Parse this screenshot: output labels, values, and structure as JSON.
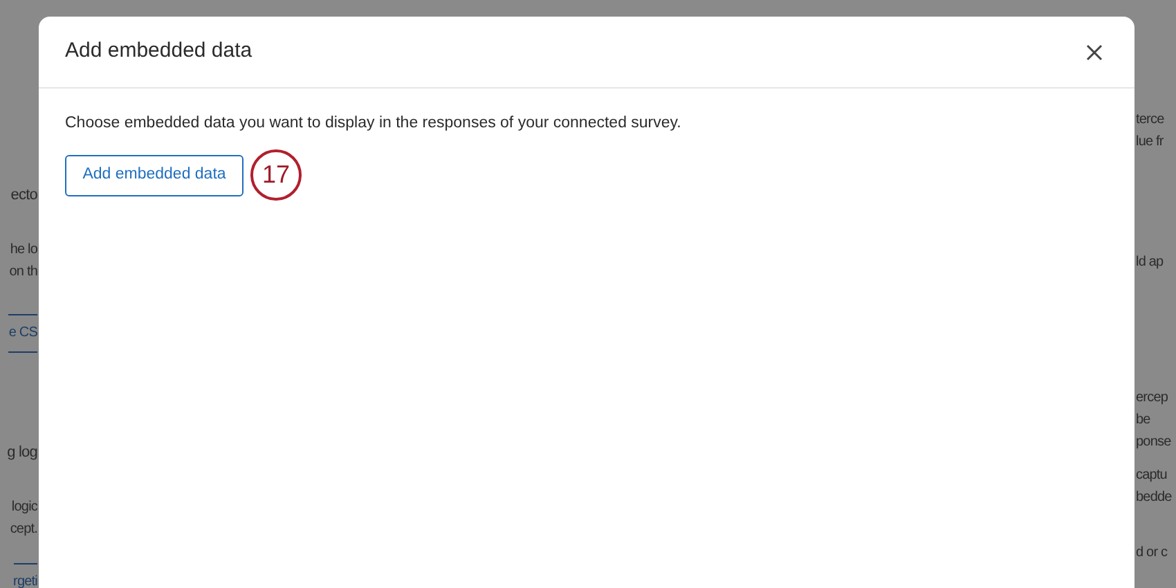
{
  "background": {
    "left": [
      {
        "kind": "heading",
        "text": "ecto"
      },
      {
        "kind": "text",
        "text": "he lo"
      },
      {
        "kind": "text",
        "text": "on th"
      },
      {
        "kind": "link",
        "text": "e CS"
      },
      {
        "kind": "heading",
        "text": "g log"
      },
      {
        "kind": "text",
        "text": "logic"
      },
      {
        "kind": "text",
        "text": "cept."
      },
      {
        "kind": "link",
        "text": "rgeti"
      }
    ],
    "right": [
      {
        "kind": "text",
        "text": "terce"
      },
      {
        "kind": "text",
        "text": "lue fr"
      },
      {
        "kind": "text",
        "text": "ld ap"
      },
      {
        "kind": "text",
        "text": "ercep"
      },
      {
        "kind": "text",
        "text": "be"
      },
      {
        "kind": "text",
        "text": "ponse"
      },
      {
        "kind": "text",
        "text": "captu"
      },
      {
        "kind": "text",
        "text": "bedde"
      },
      {
        "kind": "text",
        "text": "d or c"
      }
    ]
  },
  "dialog": {
    "title": "Add embedded data",
    "description": "Choose embedded data you want to display in the responses of your connected survey.",
    "button": "Add embedded data",
    "step_badge": "17"
  }
}
